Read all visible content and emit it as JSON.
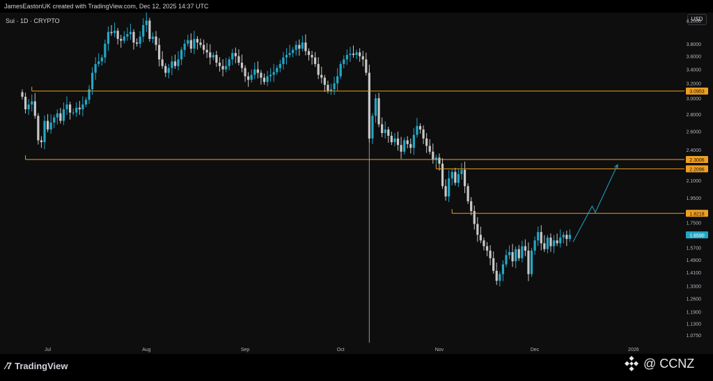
{
  "header": {
    "attribution": "JamesEastonUK created with TradingView.com, Dec 12, 2025 14:37 UTC",
    "symbol": "Sui · 1D · CRYPTO",
    "currency": "USD"
  },
  "footer": {
    "logo_text": "TradingView",
    "watermark": "@ CCNZ"
  },
  "colors": {
    "up": "#22a7c7",
    "down": "#c8c8c8",
    "level": "#f0a020",
    "current": "#22a7c7",
    "arrow": "#22a7c7"
  },
  "chart_data": {
    "type": "candlestick",
    "title": "",
    "ylim": [
      1.04,
      4.35
    ],
    "yscale": "log",
    "y_ticks": [
      "4.2000",
      "3.8000",
      "3.6000",
      "3.4000",
      "3.2000",
      "3.0000",
      "2.8000",
      "2.6000",
      "2.4000",
      "2.2000",
      "2.1000",
      "1.9500",
      "1.7500",
      "1.6500",
      "1.5700",
      "1.4900",
      "1.4100",
      "1.3300",
      "1.2600",
      "1.1900",
      "1.1300",
      "1.0750"
    ],
    "x_ticks": [
      {
        "label": "Jul",
        "x": "2025-07-01"
      },
      {
        "label": "Aug",
        "x": "2025-08-01"
      },
      {
        "label": "Sep",
        "x": "2025-09-01"
      },
      {
        "label": "Oct",
        "x": "2025-10-01"
      },
      {
        "label": "Nov",
        "x": "2025-11-01"
      },
      {
        "label": "Dec",
        "x": "2025-12-01"
      },
      {
        "label": "2026",
        "x": "2026-01-01"
      }
    ],
    "x_range": [
      "2025-06-16",
      "2026-01-17"
    ],
    "levels": [
      {
        "label": "3.0953",
        "value": 3.0953,
        "from": "2025-06-26"
      },
      {
        "label": "2.3006",
        "value": 2.3006,
        "from": "2025-06-24"
      },
      {
        "label": "2.2096",
        "value": 2.2096,
        "from": "2025-10-31"
      },
      {
        "label": "1.8218",
        "value": 1.8218,
        "from": "2025-11-05"
      }
    ],
    "current_price": {
      "label": "1.6590",
      "value": 1.659
    },
    "vertical_marker": "2025-10-10",
    "projection": [
      {
        "x": "2025-12-13",
        "y": 1.61
      },
      {
        "x": "2025-12-19",
        "y": 1.88
      },
      {
        "x": "2025-12-20",
        "y": 1.83
      },
      {
        "x": "2025-12-27",
        "y": 2.25
      }
    ],
    "path_open": 3.08,
    "path": [
      3.02,
      2.86,
      2.92,
      2.96,
      2.78,
      2.5,
      2.48,
      2.72,
      2.62,
      2.7,
      2.76,
      2.81,
      2.72,
      2.86,
      2.92,
      2.82,
      2.82,
      2.88,
      2.86,
      2.92,
      2.98,
      3.12,
      3.35,
      3.48,
      3.52,
      3.58,
      3.8,
      4.0,
      3.98,
      4.02,
      3.88,
      3.85,
      3.92,
      3.96,
      4.0,
      3.82,
      3.8,
      3.92,
      4.12,
      4.2,
      3.88,
      3.92,
      3.78,
      3.55,
      3.45,
      3.35,
      3.42,
      3.52,
      3.45,
      3.55,
      3.7,
      3.8,
      3.86,
      3.72,
      3.88,
      3.82,
      3.78,
      3.7,
      3.66,
      3.58,
      3.62,
      3.5,
      3.45,
      3.4,
      3.45,
      3.55,
      3.65,
      3.6,
      3.5,
      3.42,
      3.3,
      3.25,
      3.32,
      3.4,
      3.35,
      3.28,
      3.22,
      3.3,
      3.32,
      3.36,
      3.42,
      3.48,
      3.58,
      3.62,
      3.65,
      3.7,
      3.78,
      3.72,
      3.82,
      3.68,
      3.62,
      3.58,
      3.48,
      3.32,
      3.28,
      3.18,
      3.1,
      3.12,
      3.2,
      3.3,
      3.48,
      3.55,
      3.62,
      3.64,
      3.62,
      3.66,
      3.6,
      3.55,
      3.35,
      2.52,
      2.78,
      3.0,
      2.68,
      2.58,
      2.62,
      2.55,
      2.48,
      2.52,
      2.45,
      2.38,
      2.5,
      2.46,
      2.42,
      2.56,
      2.66,
      2.62,
      2.52,
      2.44,
      2.38,
      2.3,
      2.32,
      2.26,
      2.05,
      1.96,
      2.12,
      2.18,
      2.08,
      2.16,
      2.2,
      2.05,
      1.92,
      1.84,
      1.74,
      1.66,
      1.62,
      1.58,
      1.55,
      1.5,
      1.42,
      1.36,
      1.4,
      1.46,
      1.52,
      1.54,
      1.48,
      1.56,
      1.5,
      1.58,
      1.55,
      1.4,
      1.55,
      1.62,
      1.68,
      1.6,
      1.56,
      1.64,
      1.58,
      1.62,
      1.6,
      1.64,
      1.66,
      1.63,
      1.66
    ],
    "path_end": "2025-12-12"
  }
}
